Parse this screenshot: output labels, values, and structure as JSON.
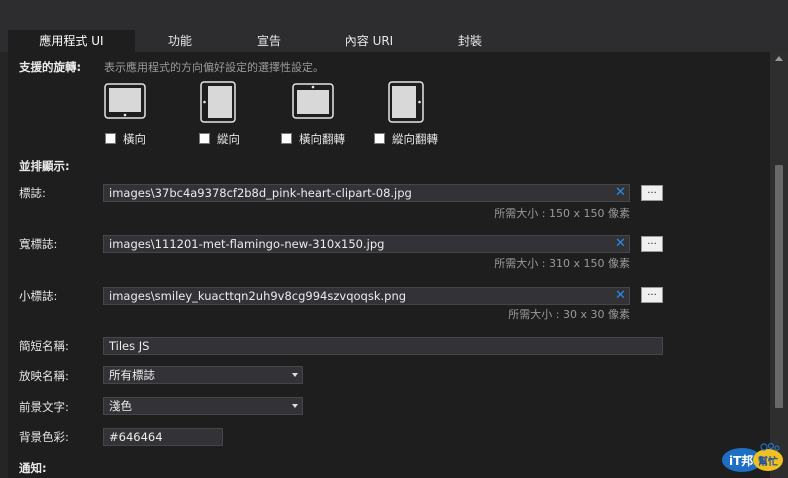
{
  "tabs": [
    "應用程式 UI",
    "功能",
    "宣告",
    "內容 URI",
    "封裝"
  ],
  "rotation": {
    "label": "支援的旋轉:",
    "description": "表示應用程式的方向偏好設定的選擇性設定。",
    "options": [
      "橫向",
      "縱向",
      "橫向翻轉",
      "縱向翻轉"
    ]
  },
  "tile_section": "並排顯示:",
  "logo": {
    "label": "標誌:",
    "value": "images\\37bc4a9378cf2b8d_pink-heart-clipart-08.jpg",
    "size_note": "所需大小 : 150 x 150 像素"
  },
  "wide_logo": {
    "label": "寬標誌:",
    "value": "images\\111201-met-flamingo-new-310x150.jpg",
    "size_note": "所需大小 : 310 x 150 像素"
  },
  "small_logo": {
    "label": "小標誌:",
    "value": "images\\smiley_kuacttqn2uh9v8cg994szvqoqsk.png",
    "size_note": "所需大小 : 30 x 30 像素"
  },
  "browse_label": "...",
  "clear_label": "✕",
  "short_name": {
    "label": "簡短名稱:",
    "value": "Tiles JS"
  },
  "show_name": {
    "label": "放映名稱:",
    "value": "所有標誌"
  },
  "foreground_text": {
    "label": "前景文字:",
    "value": "淺色"
  },
  "background_color": {
    "label": "背景色彩:",
    "value": "#646464"
  },
  "notifications_section": "通知:",
  "watermark": {
    "text": "iT邦",
    "sub": "幫忙"
  },
  "colors": {
    "panel": "#1e1e1e",
    "chrome": "#2d2d30",
    "clear_x": "#2b8be8"
  }
}
